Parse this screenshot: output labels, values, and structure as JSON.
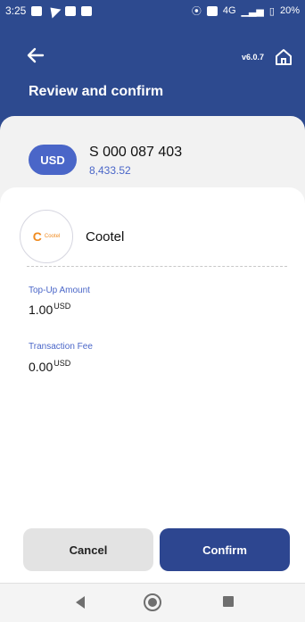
{
  "status": {
    "time": "3:25",
    "network": "4G",
    "battery": "20%"
  },
  "header": {
    "version": "v6.0.7",
    "title": "Review and confirm"
  },
  "account": {
    "currency": "USD",
    "number": "S 000 087 403",
    "balance": "8,433.52"
  },
  "provider": {
    "logo_text": "Cootel",
    "name": "Cootel"
  },
  "details": {
    "topup_label": "Top-Up Amount",
    "topup_value": "1.00",
    "topup_currency": "USD",
    "fee_label": "Transaction Fee",
    "fee_value": "0.00",
    "fee_currency": "USD"
  },
  "actions": {
    "cancel": "Cancel",
    "confirm": "Confirm"
  },
  "icons": {
    "back": "arrow-left-icon",
    "home": "home-icon"
  }
}
